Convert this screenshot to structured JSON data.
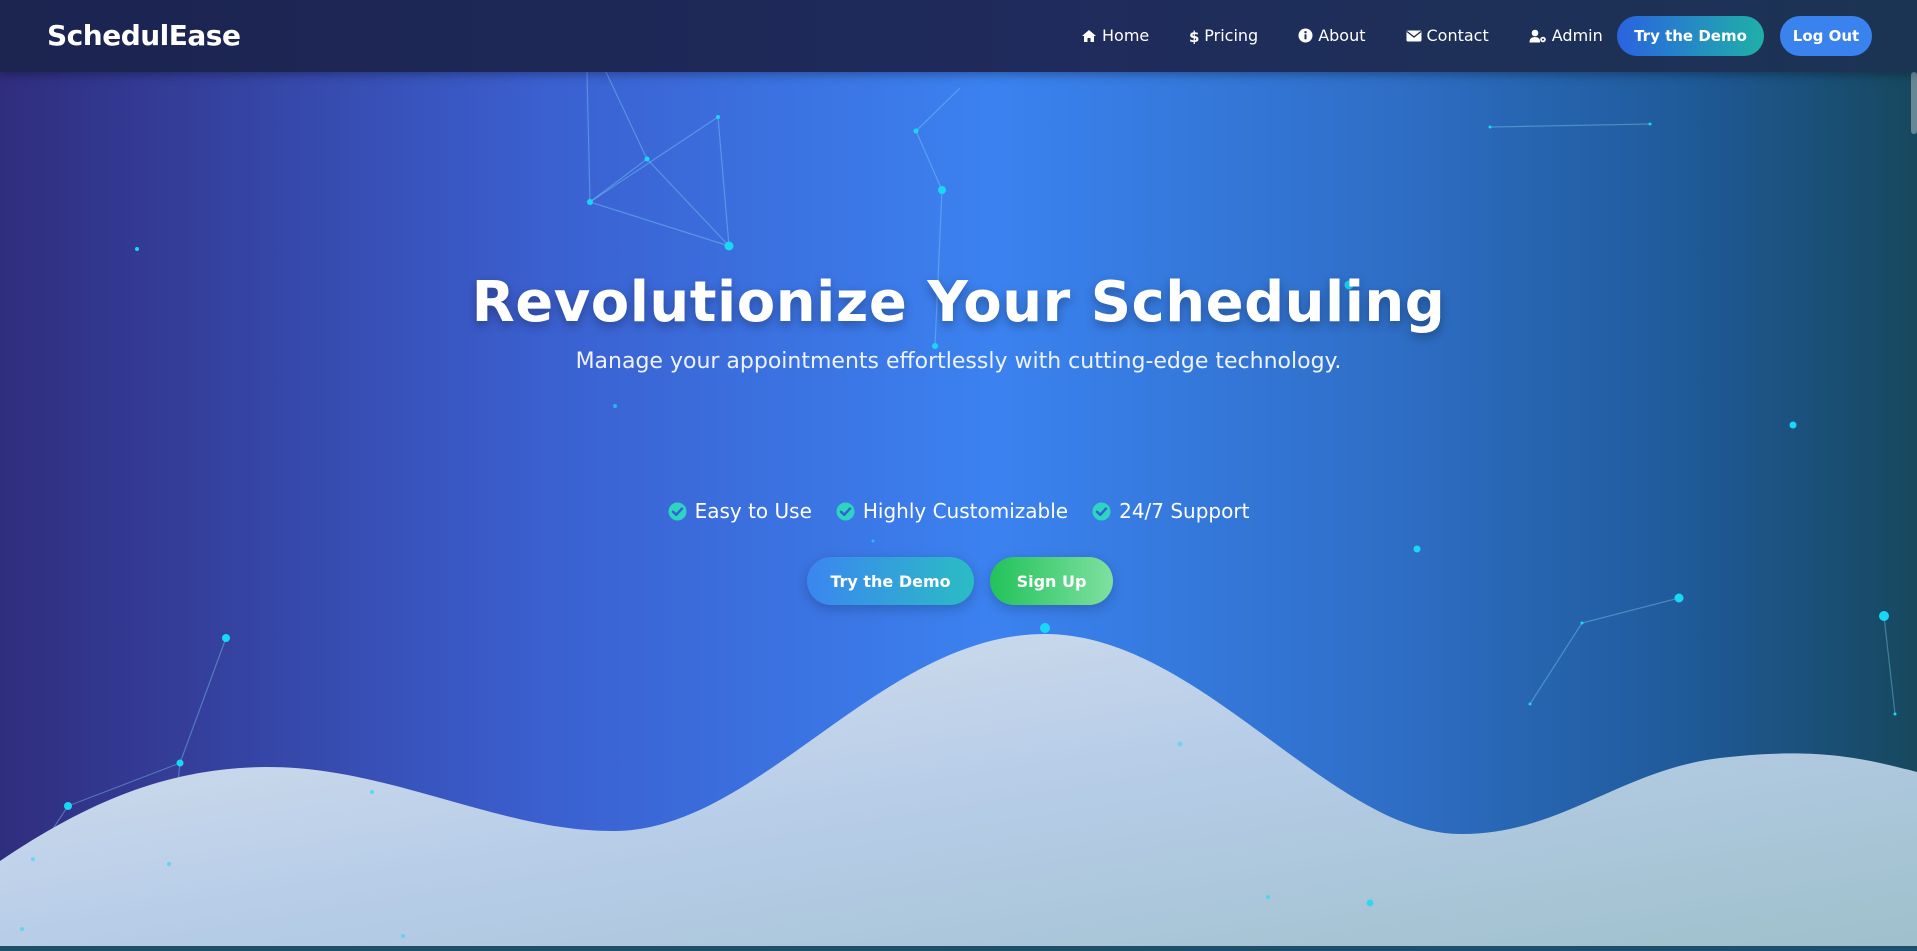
{
  "brand": "SchedulEase",
  "nav": {
    "links": [
      {
        "label": "Home",
        "icon": "home-icon"
      },
      {
        "label": "Pricing",
        "icon": "dollar-icon"
      },
      {
        "label": "About",
        "icon": "info-icon"
      },
      {
        "label": "Contact",
        "icon": "envelope-icon"
      },
      {
        "label": "Admin",
        "icon": "user-gear-icon"
      }
    ],
    "demo_label": "Try the Demo",
    "logout_label": "Log Out"
  },
  "hero": {
    "title": "Revolutionize Your Scheduling",
    "subtitle": "Manage your appointments effortlessly with cutting-edge technology.",
    "features": [
      {
        "label": "Easy to Use",
        "icon": "check-circle-icon"
      },
      {
        "label": "Highly Customizable",
        "icon": "check-circle-icon"
      },
      {
        "label": "24/7 Support",
        "icon": "check-circle-icon"
      }
    ],
    "demo_label": "Try the Demo",
    "signup_label": "Sign Up"
  },
  "colors": {
    "accent": "#3b82f0",
    "teal": "#2bbcc4",
    "green": "#22c25a",
    "particle": "#19d8f5",
    "check": "#2ed3c2"
  }
}
